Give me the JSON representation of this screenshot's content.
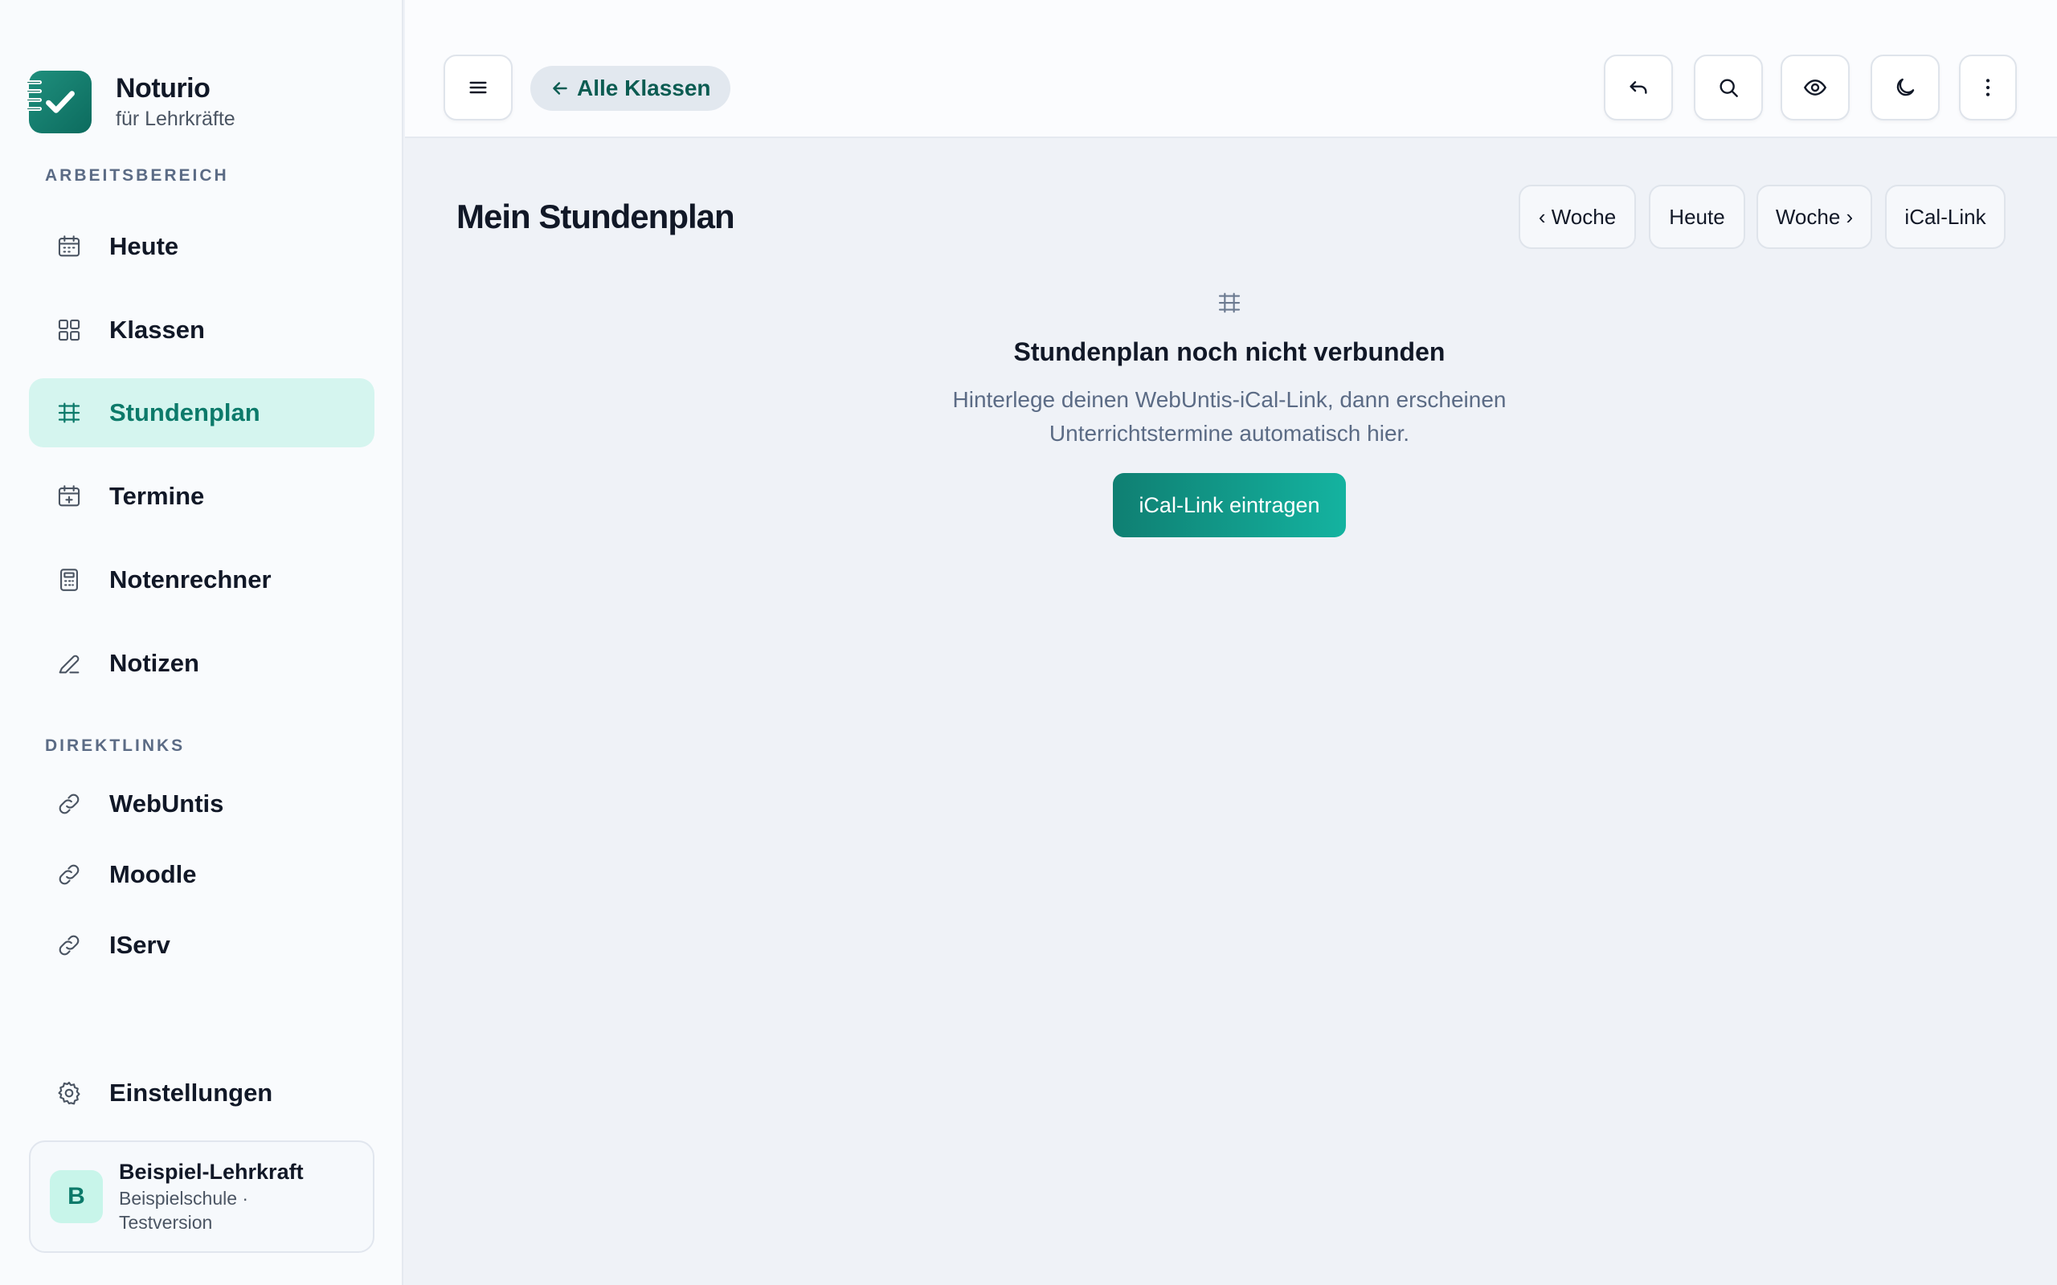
{
  "brand": {
    "name": "Noturio",
    "subtitle": "für Lehrkräfte"
  },
  "sidebar": {
    "section_workspace": "ARBEITSBEREICH",
    "workspace_items": [
      {
        "label": "Heute",
        "icon": "calendar-icon"
      },
      {
        "label": "Klassen",
        "icon": "grid-icon"
      },
      {
        "label": "Stundenplan",
        "icon": "timetable-icon",
        "active": true
      },
      {
        "label": "Termine",
        "icon": "calendar-plus-icon"
      },
      {
        "label": "Notenrechner",
        "icon": "calculator-icon"
      },
      {
        "label": "Notizen",
        "icon": "pencil-icon"
      }
    ],
    "section_links": "DIREKTLINKS",
    "link_items": [
      {
        "label": "WebUntis",
        "icon": "link-icon"
      },
      {
        "label": "Moodle",
        "icon": "link-icon"
      },
      {
        "label": "IServ",
        "icon": "link-icon"
      }
    ],
    "settings_label": "Einstellungen",
    "user": {
      "initial": "B",
      "name": "Beispiel-Lehrkraft",
      "subtitle": "Beispielschule · Testversion"
    }
  },
  "topbar": {
    "back_label": "Alle Klassen",
    "icons": [
      "menu-icon",
      "undo-icon",
      "search-icon",
      "eye-icon",
      "moon-icon",
      "more-vertical-icon"
    ]
  },
  "main": {
    "title": "Mein Stundenplan",
    "week_buttons": [
      "‹ Woche",
      "Heute",
      "Woche ›",
      "iCal-Link"
    ],
    "empty": {
      "title": "Stundenplan noch nicht verbunden",
      "description": "Hinterlege deinen WebUntis-iCal-Link, dann erscheinen Unterrichtstermine automatisch hier.",
      "button": "iCal-Link eintragen"
    }
  },
  "colors": {
    "accent": "#0c7a6a",
    "active_bg": "#d5f5ef",
    "background": "#eff2f7"
  }
}
